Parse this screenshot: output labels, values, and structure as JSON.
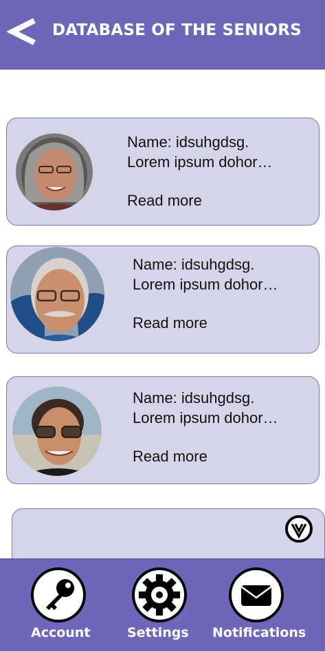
{
  "header": {
    "title": "DATABASE OF THE SENIORS",
    "back_icon": "chevron-left-icon"
  },
  "seniors": [
    {
      "name_line": "Name: idsuhgdsg.",
      "desc_line": "Lorem ipsum dohor…",
      "read_more": "Read more"
    },
    {
      "name_line": "Name: idsuhgdsg.",
      "desc_line": "Lorem ipsum dohor…",
      "read_more": "Read more"
    },
    {
      "name_line": "Name: idsuhgdsg.",
      "desc_line": "Lorem ipsum dohor…",
      "read_more": "Read more"
    }
  ],
  "partial_card": {
    "icon": "expand-down-icon"
  },
  "bottom_nav": {
    "items": [
      {
        "label": "Account",
        "icon": "key-icon"
      },
      {
        "label": "Settings",
        "icon": "gear-icon"
      },
      {
        "label": "Notifications",
        "icon": "envelope-icon"
      }
    ]
  },
  "colors": {
    "accent": "#6e66b8",
    "card_bg": "#d6d4e9",
    "card_border": "#7b76b8",
    "text": "#111111"
  }
}
